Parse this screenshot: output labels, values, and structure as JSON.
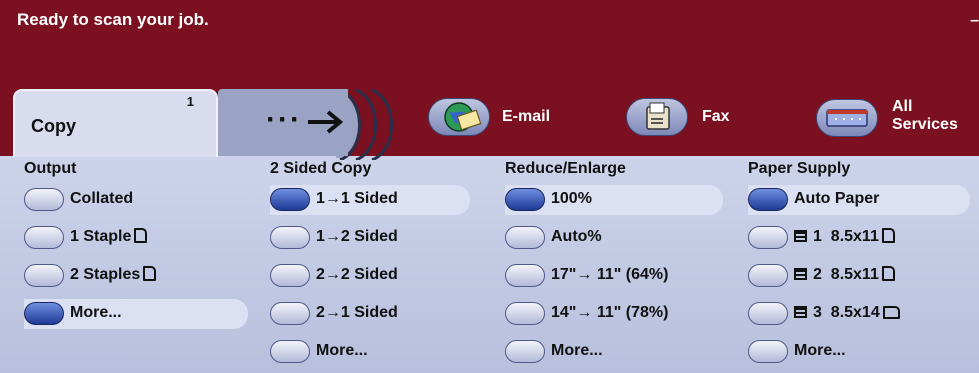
{
  "status": {
    "text": "Ready to scan your job.",
    "corner_mark": "–"
  },
  "tabs": {
    "copy": {
      "label": "Copy",
      "count": "1"
    },
    "arrow": {
      "dots": "···"
    },
    "email": {
      "label": "E-mail",
      "icon": "globe-envelope-icon"
    },
    "fax": {
      "label": "Fax",
      "icon": "fax-machine-icon"
    },
    "all_services": {
      "label_line1": "All",
      "label_line2": "Services",
      "icon": "services-panel-icon"
    }
  },
  "columns": {
    "output": {
      "title": "Output",
      "options": [
        {
          "label": "Collated",
          "selected": false
        },
        {
          "label": "1 Staple",
          "selected": false
        },
        {
          "label": "2 Staples",
          "selected": false
        },
        {
          "label": "More...",
          "selected": true
        }
      ]
    },
    "two_sided": {
      "title": "2 Sided Copy",
      "options": [
        {
          "label": "1→1 Sided",
          "selected": true
        },
        {
          "label": "1→2 Sided",
          "selected": false
        },
        {
          "label": "2→2 Sided",
          "selected": false
        },
        {
          "label": "2→1 Sided",
          "selected": false
        },
        {
          "label": "More...",
          "selected": false
        }
      ]
    },
    "reduce": {
      "title": "Reduce/Enlarge",
      "options": [
        {
          "label": "100%",
          "selected": true
        },
        {
          "label": "Auto%",
          "selected": false
        },
        {
          "label": "17\"→ 11\" (64%)",
          "selected": false
        },
        {
          "label": "14\"→ 11\" (78%)",
          "selected": false
        },
        {
          "label": "More...",
          "selected": false
        }
      ]
    },
    "paper": {
      "title": "Paper Supply",
      "options": [
        {
          "label": "Auto Paper",
          "selected": true
        },
        {
          "label": "1  8.5x11",
          "selected": false
        },
        {
          "label": "2  8.5x11",
          "selected": false
        },
        {
          "label": "3  8.5x14",
          "selected": false
        },
        {
          "label": "More...",
          "selected": false
        }
      ]
    }
  },
  "colors": {
    "header": "#7a1020",
    "panel": "#c3cae2",
    "selected": "#1e3a96"
  }
}
